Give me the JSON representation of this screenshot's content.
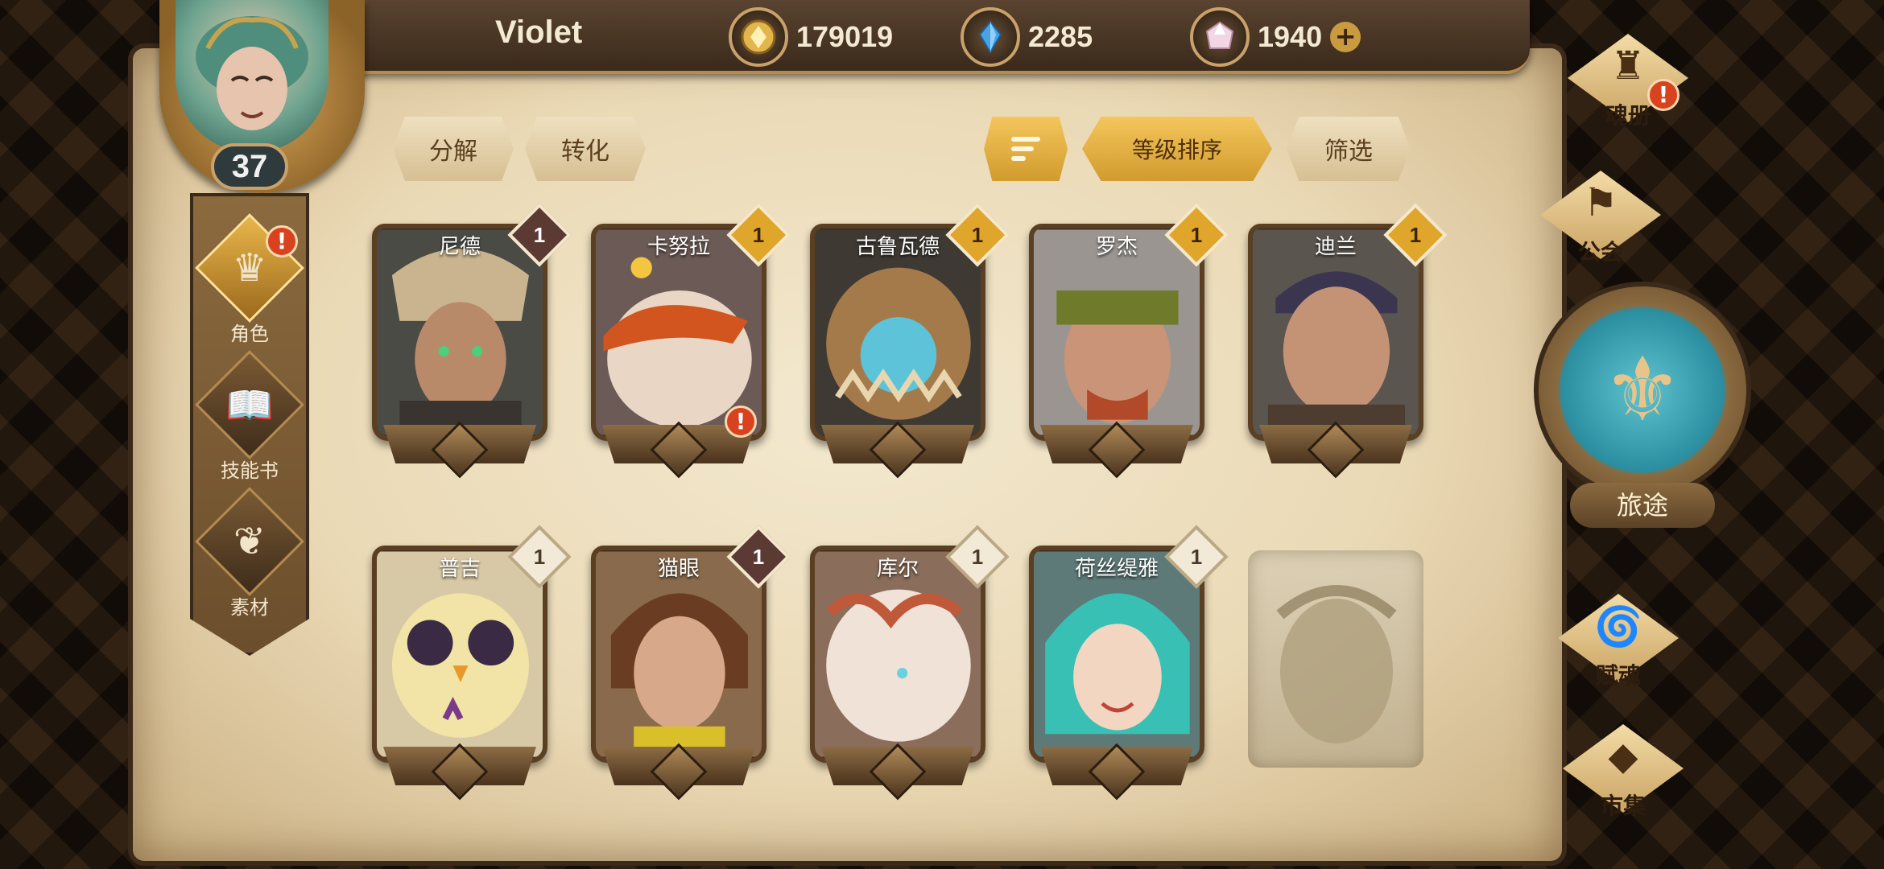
{
  "player": {
    "name": "Violet",
    "level": "37"
  },
  "currencies": [
    {
      "icon": "gold-coin-icon",
      "value": "179019"
    },
    {
      "icon": "blue-crystal-icon",
      "value": "2285"
    },
    {
      "icon": "pink-gem-icon",
      "value": "1940"
    }
  ],
  "sidenav": {
    "items": [
      {
        "label": "角色",
        "icon": "character-icon",
        "alert": "!"
      },
      {
        "label": "技能书",
        "icon": "skill-book-icon"
      },
      {
        "label": "素材",
        "icon": "material-icon"
      }
    ]
  },
  "toolbar": {
    "decompose": "分解",
    "convert": "转化",
    "sort_level": "等级排序",
    "filter": "筛选"
  },
  "heroes": [
    {
      "name": "尼德",
      "count": "1"
    },
    {
      "name": "卡努拉",
      "count": "1",
      "alert": "!"
    },
    {
      "name": "古鲁瓦德",
      "count": "1"
    },
    {
      "name": "罗杰",
      "count": "1"
    },
    {
      "name": "迪兰",
      "count": "1"
    },
    {
      "name": "普吉",
      "count": "1"
    },
    {
      "name": "猫眼",
      "count": "1"
    },
    {
      "name": "库尔",
      "count": "1"
    },
    {
      "name": "荷丝缇雅",
      "count": "1"
    }
  ],
  "rightmenu": {
    "soul_book": "魂册",
    "soul_book_alert": "!",
    "guild": "公会",
    "journey": "旅途",
    "endow": "赋魂",
    "market": "市集"
  },
  "colors": {
    "parchment": "#ead9b5",
    "gold_badge": "#e0a52b",
    "dark_badge": "#5c3a34",
    "alert": "#d8421e",
    "journey_teal": "#5fc3d0"
  }
}
